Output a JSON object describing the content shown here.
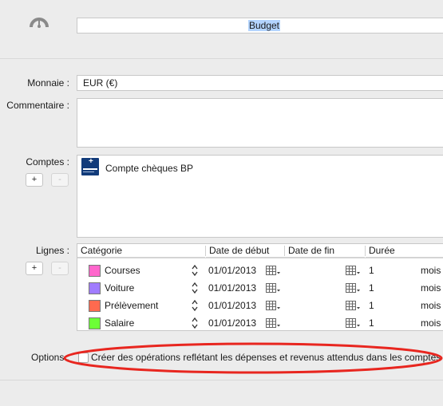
{
  "header": {
    "icon": "gauge-icon",
    "name_value": "Budget"
  },
  "form": {
    "monnaie_label": "Monnaie :",
    "monnaie_value": "EUR (€)",
    "commentaire_label": "Commentaire :",
    "commentaire_value": "",
    "comptes_label": "Comptes :",
    "lignes_label": "Lignes :",
    "options_label": "Options :"
  },
  "buttons": {
    "add": "+",
    "remove": "-"
  },
  "accounts": [
    {
      "name": "Compte chèques BP",
      "icon": "banque-populaire-logo"
    }
  ],
  "lines_table": {
    "columns": [
      "Catégorie",
      "Date de début",
      "Date de fin",
      "Durée"
    ],
    "rows": [
      {
        "category": "Courses",
        "color": "#ff66cc",
        "start": "01/01/2013",
        "end": "",
        "duration": "1",
        "unit": "mois"
      },
      {
        "category": "Voiture",
        "color": "#a07cff",
        "start": "01/01/2013",
        "end": "",
        "duration": "1",
        "unit": "mois"
      },
      {
        "category": "Prélèvement",
        "color": "#ff6a4f",
        "start": "01/01/2013",
        "end": "",
        "duration": "1",
        "unit": "mois"
      },
      {
        "category": "Salaire",
        "color": "#6cff36",
        "start": "01/01/2013",
        "end": "",
        "duration": "1",
        "unit": "mois"
      }
    ]
  },
  "options": {
    "checkbox_label": "Créer des opérations reflétant les dépenses et revenus attendus dans les comptes",
    "checked": false
  },
  "colors": {
    "highlight_ellipse": "#e8261f",
    "text_selection": "#b3d4fe"
  }
}
